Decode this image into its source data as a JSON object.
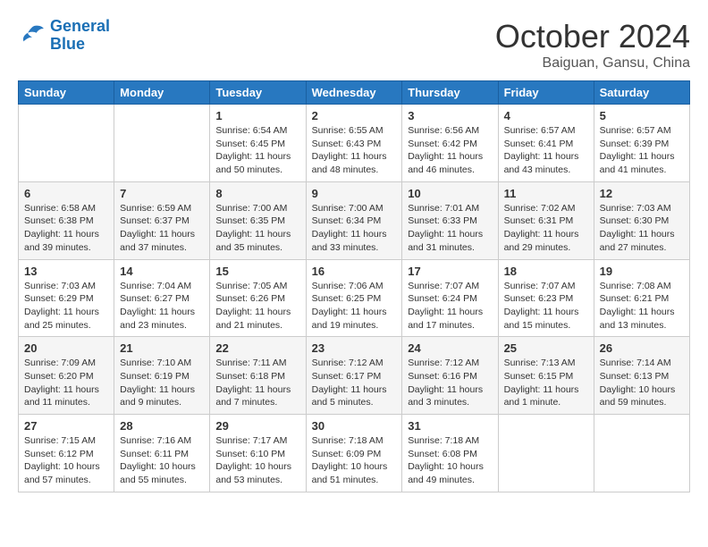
{
  "logo": {
    "line1": "General",
    "line2": "Blue"
  },
  "title": "October 2024",
  "location": "Baiguan, Gansu, China",
  "weekdays": [
    "Sunday",
    "Monday",
    "Tuesday",
    "Wednesday",
    "Thursday",
    "Friday",
    "Saturday"
  ],
  "weeks": [
    [
      {
        "day": "",
        "sunrise": "",
        "sunset": "",
        "daylight": ""
      },
      {
        "day": "",
        "sunrise": "",
        "sunset": "",
        "daylight": ""
      },
      {
        "day": "1",
        "sunrise": "Sunrise: 6:54 AM",
        "sunset": "Sunset: 6:45 PM",
        "daylight": "Daylight: 11 hours and 50 minutes."
      },
      {
        "day": "2",
        "sunrise": "Sunrise: 6:55 AM",
        "sunset": "Sunset: 6:43 PM",
        "daylight": "Daylight: 11 hours and 48 minutes."
      },
      {
        "day": "3",
        "sunrise": "Sunrise: 6:56 AM",
        "sunset": "Sunset: 6:42 PM",
        "daylight": "Daylight: 11 hours and 46 minutes."
      },
      {
        "day": "4",
        "sunrise": "Sunrise: 6:57 AM",
        "sunset": "Sunset: 6:41 PM",
        "daylight": "Daylight: 11 hours and 43 minutes."
      },
      {
        "day": "5",
        "sunrise": "Sunrise: 6:57 AM",
        "sunset": "Sunset: 6:39 PM",
        "daylight": "Daylight: 11 hours and 41 minutes."
      }
    ],
    [
      {
        "day": "6",
        "sunrise": "Sunrise: 6:58 AM",
        "sunset": "Sunset: 6:38 PM",
        "daylight": "Daylight: 11 hours and 39 minutes."
      },
      {
        "day": "7",
        "sunrise": "Sunrise: 6:59 AM",
        "sunset": "Sunset: 6:37 PM",
        "daylight": "Daylight: 11 hours and 37 minutes."
      },
      {
        "day": "8",
        "sunrise": "Sunrise: 7:00 AM",
        "sunset": "Sunset: 6:35 PM",
        "daylight": "Daylight: 11 hours and 35 minutes."
      },
      {
        "day": "9",
        "sunrise": "Sunrise: 7:00 AM",
        "sunset": "Sunset: 6:34 PM",
        "daylight": "Daylight: 11 hours and 33 minutes."
      },
      {
        "day": "10",
        "sunrise": "Sunrise: 7:01 AM",
        "sunset": "Sunset: 6:33 PM",
        "daylight": "Daylight: 11 hours and 31 minutes."
      },
      {
        "day": "11",
        "sunrise": "Sunrise: 7:02 AM",
        "sunset": "Sunset: 6:31 PM",
        "daylight": "Daylight: 11 hours and 29 minutes."
      },
      {
        "day": "12",
        "sunrise": "Sunrise: 7:03 AM",
        "sunset": "Sunset: 6:30 PM",
        "daylight": "Daylight: 11 hours and 27 minutes."
      }
    ],
    [
      {
        "day": "13",
        "sunrise": "Sunrise: 7:03 AM",
        "sunset": "Sunset: 6:29 PM",
        "daylight": "Daylight: 11 hours and 25 minutes."
      },
      {
        "day": "14",
        "sunrise": "Sunrise: 7:04 AM",
        "sunset": "Sunset: 6:27 PM",
        "daylight": "Daylight: 11 hours and 23 minutes."
      },
      {
        "day": "15",
        "sunrise": "Sunrise: 7:05 AM",
        "sunset": "Sunset: 6:26 PM",
        "daylight": "Daylight: 11 hours and 21 minutes."
      },
      {
        "day": "16",
        "sunrise": "Sunrise: 7:06 AM",
        "sunset": "Sunset: 6:25 PM",
        "daylight": "Daylight: 11 hours and 19 minutes."
      },
      {
        "day": "17",
        "sunrise": "Sunrise: 7:07 AM",
        "sunset": "Sunset: 6:24 PM",
        "daylight": "Daylight: 11 hours and 17 minutes."
      },
      {
        "day": "18",
        "sunrise": "Sunrise: 7:07 AM",
        "sunset": "Sunset: 6:23 PM",
        "daylight": "Daylight: 11 hours and 15 minutes."
      },
      {
        "day": "19",
        "sunrise": "Sunrise: 7:08 AM",
        "sunset": "Sunset: 6:21 PM",
        "daylight": "Daylight: 11 hours and 13 minutes."
      }
    ],
    [
      {
        "day": "20",
        "sunrise": "Sunrise: 7:09 AM",
        "sunset": "Sunset: 6:20 PM",
        "daylight": "Daylight: 11 hours and 11 minutes."
      },
      {
        "day": "21",
        "sunrise": "Sunrise: 7:10 AM",
        "sunset": "Sunset: 6:19 PM",
        "daylight": "Daylight: 11 hours and 9 minutes."
      },
      {
        "day": "22",
        "sunrise": "Sunrise: 7:11 AM",
        "sunset": "Sunset: 6:18 PM",
        "daylight": "Daylight: 11 hours and 7 minutes."
      },
      {
        "day": "23",
        "sunrise": "Sunrise: 7:12 AM",
        "sunset": "Sunset: 6:17 PM",
        "daylight": "Daylight: 11 hours and 5 minutes."
      },
      {
        "day": "24",
        "sunrise": "Sunrise: 7:12 AM",
        "sunset": "Sunset: 6:16 PM",
        "daylight": "Daylight: 11 hours and 3 minutes."
      },
      {
        "day": "25",
        "sunrise": "Sunrise: 7:13 AM",
        "sunset": "Sunset: 6:15 PM",
        "daylight": "Daylight: 11 hours and 1 minute."
      },
      {
        "day": "26",
        "sunrise": "Sunrise: 7:14 AM",
        "sunset": "Sunset: 6:13 PM",
        "daylight": "Daylight: 10 hours and 59 minutes."
      }
    ],
    [
      {
        "day": "27",
        "sunrise": "Sunrise: 7:15 AM",
        "sunset": "Sunset: 6:12 PM",
        "daylight": "Daylight: 10 hours and 57 minutes."
      },
      {
        "day": "28",
        "sunrise": "Sunrise: 7:16 AM",
        "sunset": "Sunset: 6:11 PM",
        "daylight": "Daylight: 10 hours and 55 minutes."
      },
      {
        "day": "29",
        "sunrise": "Sunrise: 7:17 AM",
        "sunset": "Sunset: 6:10 PM",
        "daylight": "Daylight: 10 hours and 53 minutes."
      },
      {
        "day": "30",
        "sunrise": "Sunrise: 7:18 AM",
        "sunset": "Sunset: 6:09 PM",
        "daylight": "Daylight: 10 hours and 51 minutes."
      },
      {
        "day": "31",
        "sunrise": "Sunrise: 7:18 AM",
        "sunset": "Sunset: 6:08 PM",
        "daylight": "Daylight: 10 hours and 49 minutes."
      },
      {
        "day": "",
        "sunrise": "",
        "sunset": "",
        "daylight": ""
      },
      {
        "day": "",
        "sunrise": "",
        "sunset": "",
        "daylight": ""
      }
    ]
  ]
}
